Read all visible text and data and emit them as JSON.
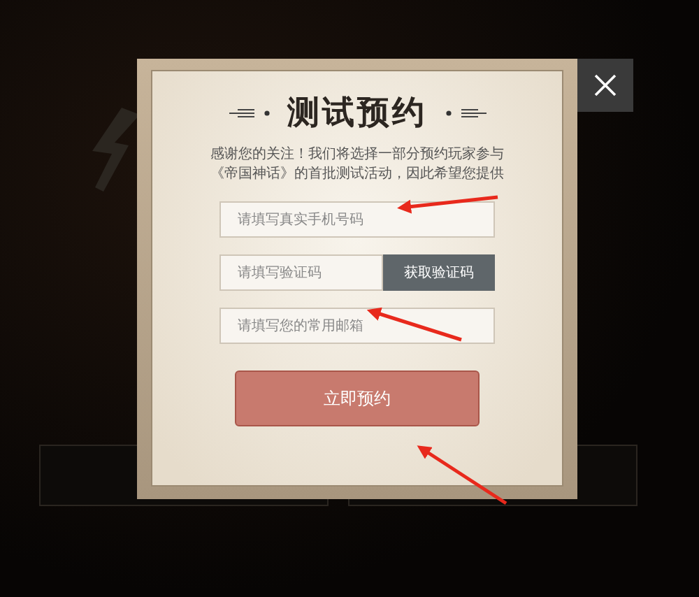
{
  "dialog": {
    "title": "测试预约",
    "intro_lines": [
      "感谢您的关注！我们将选择一部分预约玩家参与",
      "《帝国神话》的首批测试活动，因此希望您提供"
    ],
    "fields": [
      {
        "kind": "input",
        "placeholder": "请填写真实手机号码"
      },
      {
        "kind": "code",
        "placeholder": "请填写验证码",
        "button": "获取验证码"
      },
      {
        "kind": "input",
        "placeholder": "请填写您的常用邮箱"
      }
    ],
    "submit": "立即预约"
  }
}
